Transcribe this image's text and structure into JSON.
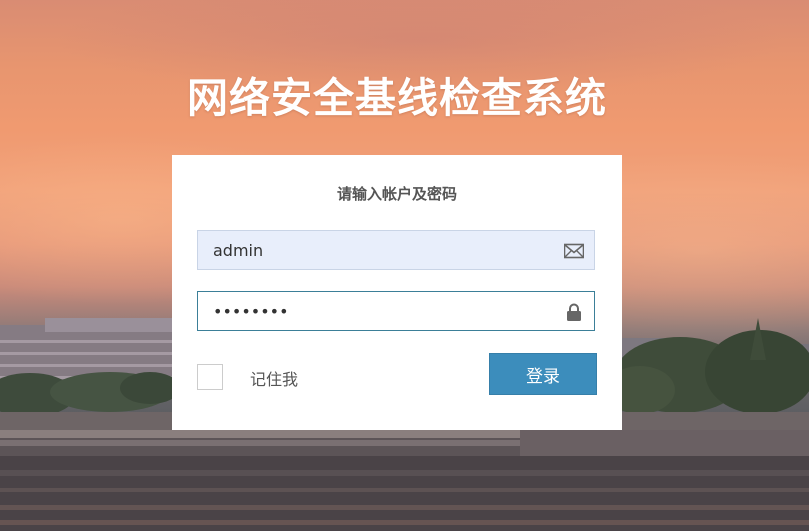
{
  "page": {
    "title": "网络安全基线检查系统"
  },
  "login_panel": {
    "heading": "请输入帐户及密码",
    "username": {
      "value": "admin",
      "icon": "envelope-icon"
    },
    "password": {
      "value": "••••••••",
      "icon": "lock-icon"
    },
    "remember": {
      "label": "记住我",
      "checked": false
    },
    "login_button_label": "登录"
  },
  "colors": {
    "accent": "#3c8dbc",
    "username_bg": "#e8eefb",
    "password_border": "#3b7f98",
    "title_text": "#ffffff"
  }
}
